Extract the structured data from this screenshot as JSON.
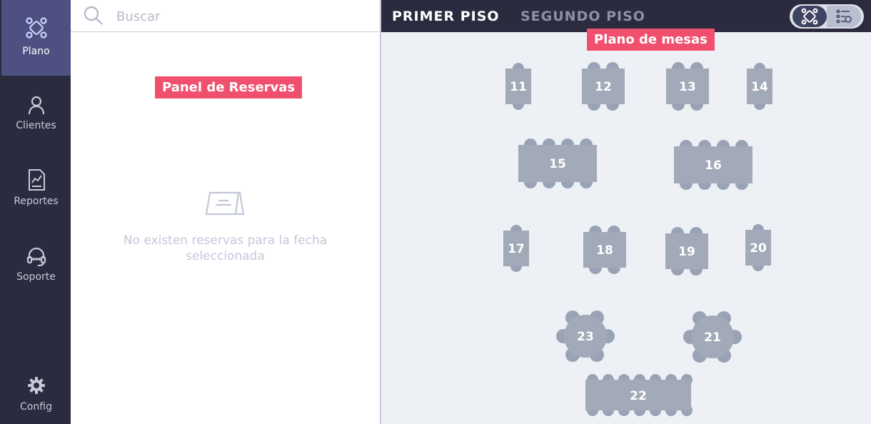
{
  "sidebar": {
    "items": [
      {
        "label": "Plano",
        "icon": "floor-plan-icon",
        "active": true
      },
      {
        "label": "Clientes",
        "icon": "user-icon",
        "active": false
      },
      {
        "label": "Reportes",
        "icon": "report-icon",
        "active": false
      },
      {
        "label": "Soporte",
        "icon": "headset-icon",
        "active": false
      }
    ],
    "config": {
      "label": "Config",
      "icon": "gear-icon"
    }
  },
  "panel": {
    "search_placeholder": "Buscar",
    "callout": "Panel de Reservas",
    "empty_state": {
      "icon": "tent-card-icon",
      "line1": "No existen reservas para la fecha",
      "line2": "seleccionada"
    }
  },
  "floorplan": {
    "callout": "Plano de mesas",
    "tabs": [
      {
        "label": "PRIMER PISO",
        "active": true
      },
      {
        "label": "SEGUNDO PISO",
        "active": false
      }
    ],
    "view_toggle": [
      {
        "icon": "plan-view-icon",
        "active": true
      },
      {
        "icon": "list-view-icon",
        "active": false
      }
    ],
    "tables": [
      {
        "number": "11",
        "shape": "rect",
        "seats": 2
      },
      {
        "number": "12",
        "shape": "rect",
        "seats": 4
      },
      {
        "number": "13",
        "shape": "rect",
        "seats": 4
      },
      {
        "number": "14",
        "shape": "rect",
        "seats": 2
      },
      {
        "number": "15",
        "shape": "rect",
        "seats": 8
      },
      {
        "number": "16",
        "shape": "rect",
        "seats": 8
      },
      {
        "number": "17",
        "shape": "rect",
        "seats": 2
      },
      {
        "number": "18",
        "shape": "rect",
        "seats": 4
      },
      {
        "number": "19",
        "shape": "rect",
        "seats": 4
      },
      {
        "number": "20",
        "shape": "rect",
        "seats": 2
      },
      {
        "number": "23",
        "shape": "round",
        "seats": 6
      },
      {
        "number": "21",
        "shape": "round",
        "seats": 6
      },
      {
        "number": "22",
        "shape": "rect",
        "seats": 14
      }
    ]
  },
  "colors": {
    "sidebar_bg": "#2b2b3f",
    "sidebar_active": "#4d5080",
    "callout_bg": "#f0506e",
    "table_fill": "#a2a9b8",
    "floor_bg": "#edf1f5",
    "tab_active": "#ffffff",
    "tab_inactive": "#8d91a5"
  }
}
